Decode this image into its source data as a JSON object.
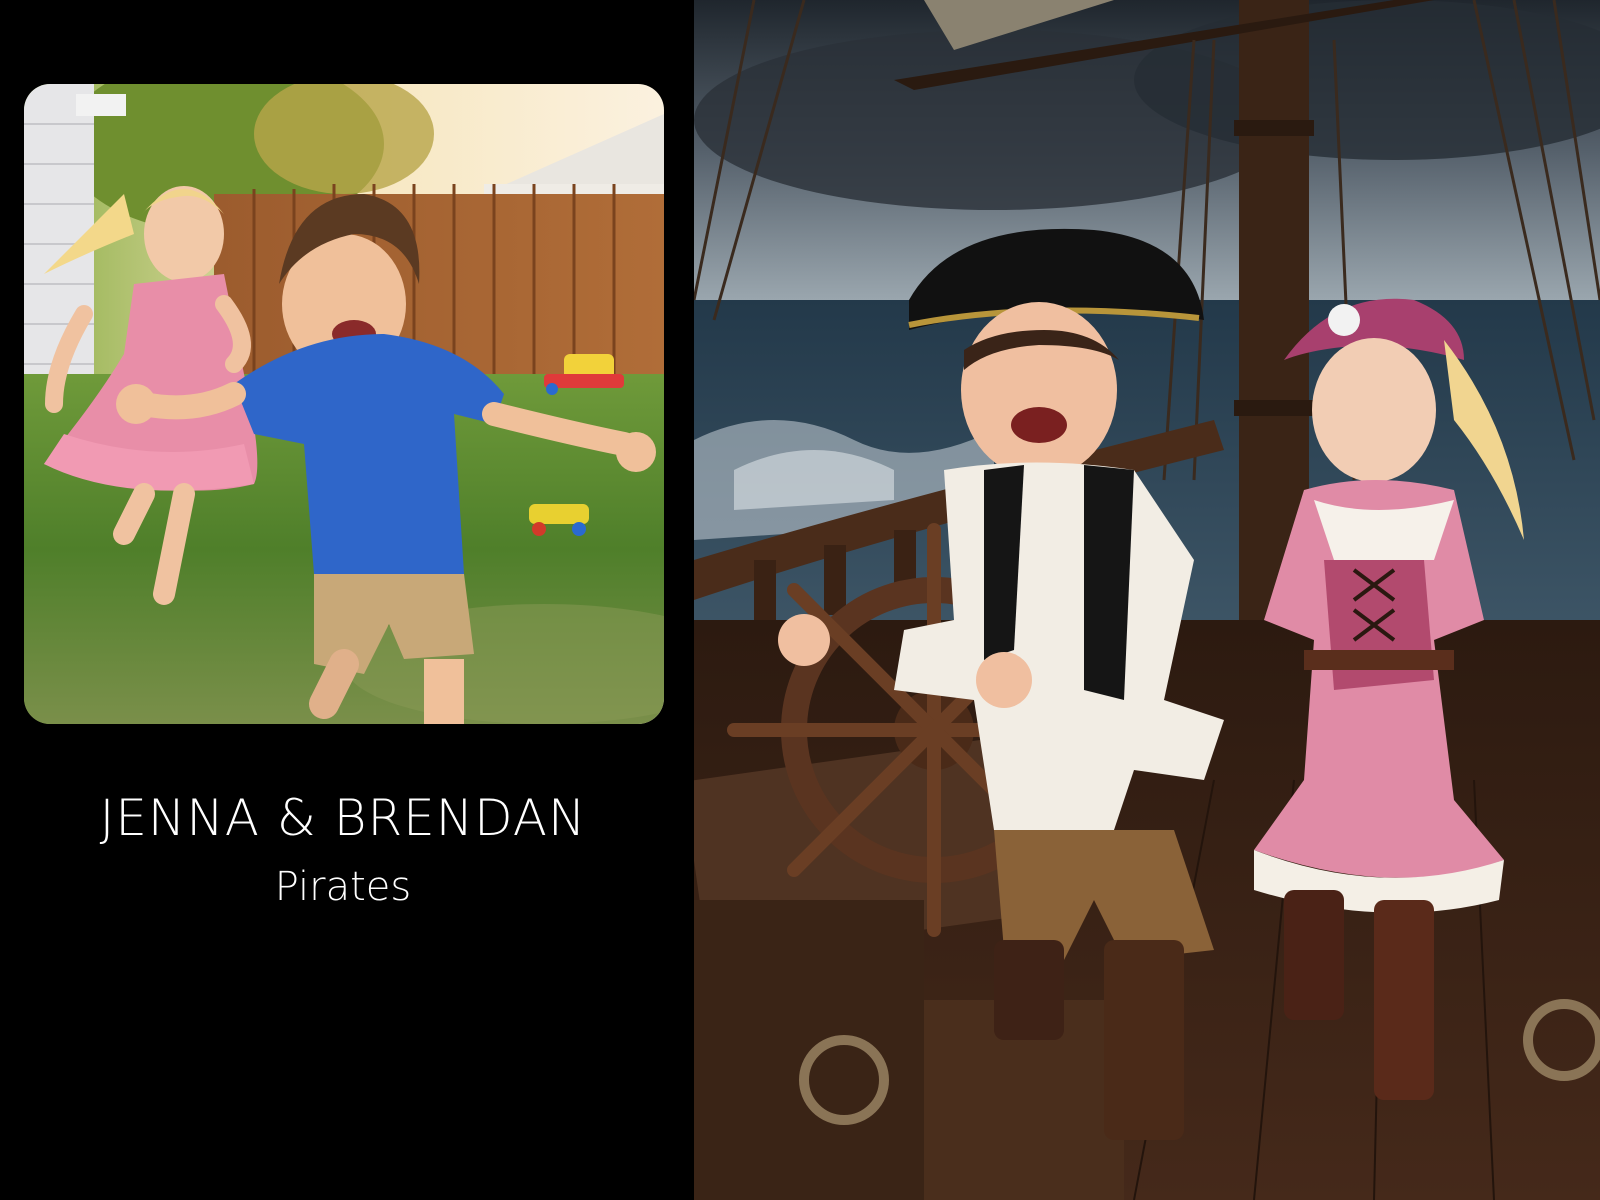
{
  "caption": {
    "title": "JENNA & BRENDAN",
    "subtitle": "Pirates"
  },
  "colors": {
    "background": "#000000",
    "caption_text": "#ffffff",
    "girl_dress": "#e58aa6",
    "boy_shirt": "#2f66c9",
    "storm_sky": "#3c4650",
    "ship_wood": "#4a2c1a"
  },
  "photos": {
    "left": "backyard-children-running",
    "right": "children-dressed-as-pirates-on-ship-deck"
  }
}
